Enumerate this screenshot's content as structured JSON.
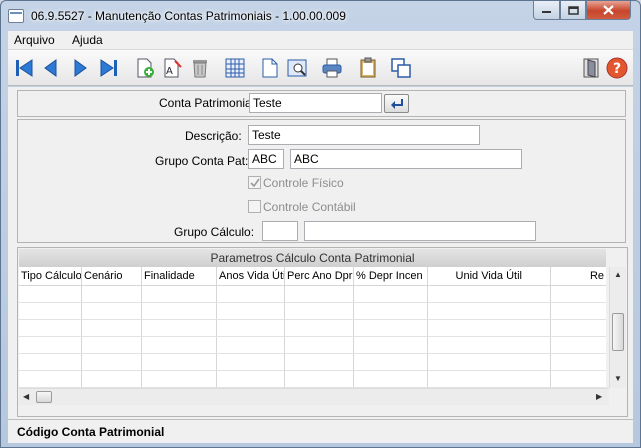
{
  "window": {
    "title": "06.9.5527 - Manutenção Contas Patrimoniais - 1.00.00.009"
  },
  "menu": {
    "items": [
      "Arquivo",
      "Ajuda"
    ]
  },
  "toolbar": {
    "icons": [
      "first-record-icon",
      "prev-record-icon",
      "next-record-icon",
      "last-record-icon",
      "new-record-icon",
      "edit-record-icon",
      "delete-icon",
      "calculator-icon",
      "document-icon",
      "preview-icon",
      "print-icon",
      "clipboard-icon",
      "copy-icon",
      "exit-door-icon",
      "help-icon"
    ],
    "help_glyph": "?"
  },
  "header": {
    "conta_label": "Conta Patrimonial:",
    "conta_value": "Teste"
  },
  "form": {
    "descricao_label": "Descrição:",
    "descricao_value": "Teste",
    "grupo_pat_label": "Grupo Conta Pat:",
    "grupo_pat_code": "ABC",
    "grupo_pat_desc": "ABC",
    "controle_fisico_label": "Controle Físico",
    "controle_fisico_checked": true,
    "controle_contabil_label": "Controle Contábil",
    "controle_contabil_checked": false,
    "grupo_calculo_label": "Grupo Cálculo:",
    "grupo_calculo_code": "",
    "grupo_calculo_desc": ""
  },
  "grid": {
    "title": "Parametros Cálculo Conta Patrimonial",
    "columns": [
      "Tipo Cálculo",
      "Cenário",
      "Finalidade",
      "Anos Vida Útil",
      "Perc Ano Dpr",
      "% Depr Incen",
      "Unid Vida Útil",
      "Re"
    ]
  },
  "status": {
    "text": "Código Conta Patrimonial"
  }
}
